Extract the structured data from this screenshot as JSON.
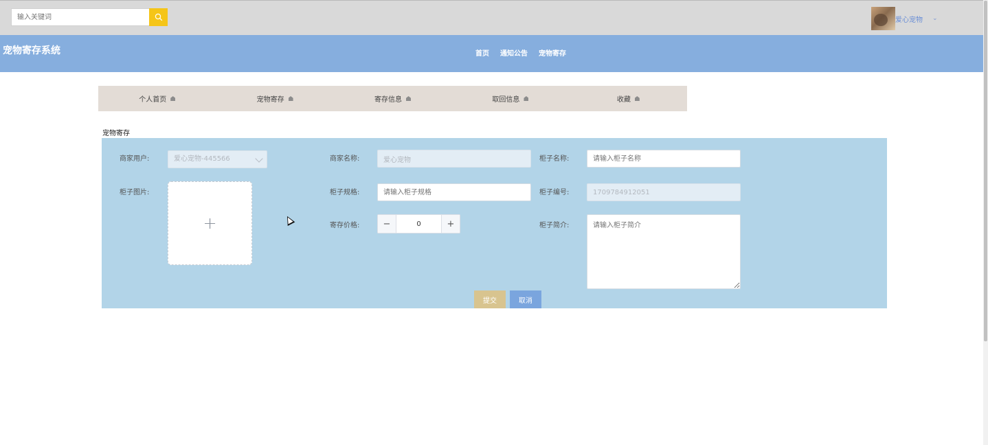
{
  "header": {
    "search_placeholder": "输入关键词",
    "username": "爱心宠物",
    "user_caret": "⌄"
  },
  "navbar": {
    "site_title": "宠物寄存系统",
    "links": [
      "首页",
      "通知公告",
      "宠物寄存"
    ]
  },
  "tabs": [
    "个人首页",
    "宠物寄存",
    "寄存信息",
    "取回信息",
    "收藏"
  ],
  "section_label": "宠物寄存",
  "form": {
    "merchant_user_label": "商家用户:",
    "merchant_user_value": "爱心宠物-445566",
    "merchant_name_label": "商家名称:",
    "merchant_name_value": "爱心宠物",
    "cabinet_name_label": "柜子名称:",
    "cabinet_name_placeholder": "请输入柜子名称",
    "cabinet_image_label": "柜子图片:",
    "upload_plus": "+",
    "cabinet_spec_label": "柜子规格:",
    "cabinet_spec_placeholder": "请输入柜子规格",
    "cabinet_no_label": "柜子编号:",
    "cabinet_no_value": "1709784912051",
    "price_label": "寄存价格:",
    "price_value": "0",
    "minus": "−",
    "plus": "+",
    "intro_label": "柜子简介:",
    "intro_placeholder": "请输入柜子简介",
    "submit": "提交",
    "cancel": "取消"
  },
  "colors": {
    "topbar": "#d9d9d9",
    "navbar": "#86aede",
    "search_button": "#f5c518",
    "tabs_bg": "#e3dcd6",
    "form_panel": "#b2d4e8",
    "submit": "#d8c48f",
    "cancel": "#7aa5de"
  }
}
